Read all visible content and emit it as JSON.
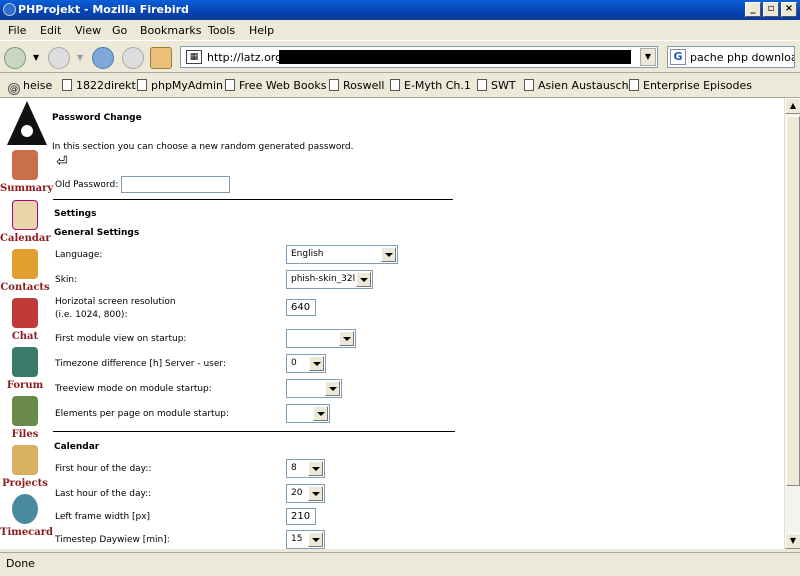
{
  "window": {
    "title": "PHProjekt - Mozilla Firebird"
  },
  "menu": [
    "File",
    "Edit",
    "View",
    "Go",
    "Bookmarks",
    "Tools",
    "Help"
  ],
  "nav": {
    "url": "http://latz.org/",
    "search": "pache php download"
  },
  "bookmarks": [
    "heise",
    "1822direkt",
    "phpMyAdmin",
    "Free Web Books",
    "Roswell",
    "E-Myth Ch.1",
    "SWT",
    "Asien Austausch",
    "Enterprise Episodes"
  ],
  "modules": [
    "Summary",
    "Calendar",
    "Contacts",
    "Chat",
    "Forum",
    "Files",
    "Projects",
    "Timecard"
  ],
  "page": {
    "title": "Password Change",
    "intro": "In this section you can choose a new random generated password.",
    "old_password_label": "Old Password:",
    "settings_heading": "Settings",
    "general_heading": "General Settings",
    "language_label": "Language:",
    "language_value": "English",
    "skin_label": "Skin:",
    "skin_value": "phish-skin_32l",
    "resolution_label_1": "Horizotal screen resolution",
    "resolution_label_2": "(i.e. 1024, 800):",
    "resolution_value": "640",
    "first_module_label": "First module view on startup:",
    "first_module_value": "",
    "timezone_label": "Timezone difference [h] Server - user:",
    "timezone_value": "0",
    "treeview_label": "Treeview mode on module startup:",
    "treeview_value": "",
    "elements_label": "Elements per page on module startup:",
    "elements_value": "",
    "calendar_heading": "Calendar",
    "first_hour_label": "First hour of the day::",
    "first_hour_value": "8",
    "last_hour_label": "Last hour of the day::",
    "last_hour_value": "20",
    "left_frame_label": "Left frame width [px]",
    "left_frame_value": "210",
    "timestep_label": "Timestep Daywiew [min]:",
    "timestep_value": "15"
  },
  "status": "Done"
}
